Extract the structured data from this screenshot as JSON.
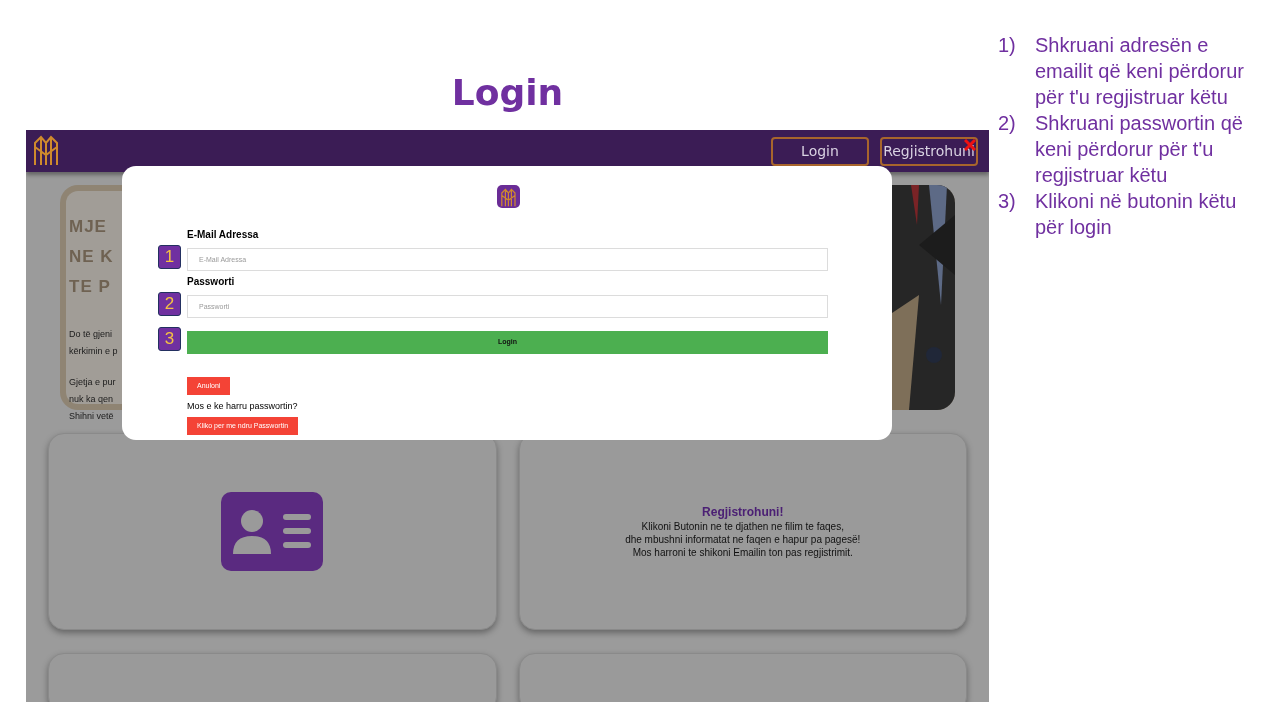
{
  "slide": {
    "title": "Login",
    "instructions": [
      {
        "number": "1)",
        "text": "Shkruani adresën e emailit që keni përdorur për t'u regjistruar këtu"
      },
      {
        "number": "2)",
        "text": "Shkruani passwortin që keni përdorur për t'u regjistruar këtu"
      },
      {
        "number": "3)",
        "text": "Klikoni në butonin këtu për login"
      }
    ]
  },
  "screenshot": {
    "navbar": {
      "buttons": [
        "Login",
        "Regjistrohuni"
      ]
    },
    "hero": {
      "heading_lines": [
        "MJE",
        "NE K",
        "TE P"
      ],
      "paragraphs": [
        [
          "Do të gjeni",
          "kërkimin e p"
        ],
        [
          "Gjetja e pur",
          "nuk ka qen",
          "Shihni vetë"
        ]
      ]
    },
    "cards": [
      {
        "kind": "icon"
      },
      {
        "kind": "text",
        "title": "Regjistrohuni!",
        "lines": [
          "Klikoni Butonin ne te djathen ne filim te faqes,",
          "dhe mbushni informatat ne faqen e hapur pa pagesë!",
          "Mos harroni te shikoni Emailin ton pas regjistrimit."
        ]
      }
    ],
    "modal": {
      "fields": [
        {
          "label": "E-Mail Adressa",
          "placeholder": "E-Mail Adressa",
          "step": "1"
        },
        {
          "label": "Passworti",
          "placeholder": "Passworti",
          "step": "2"
        }
      ],
      "submit": {
        "label": "Login",
        "step": "3"
      },
      "cancel": "Anuloni",
      "forgot_text": "Mos e ke harru passwortin?",
      "reset_button": "Kliko per me ndru Passwortin"
    }
  }
}
